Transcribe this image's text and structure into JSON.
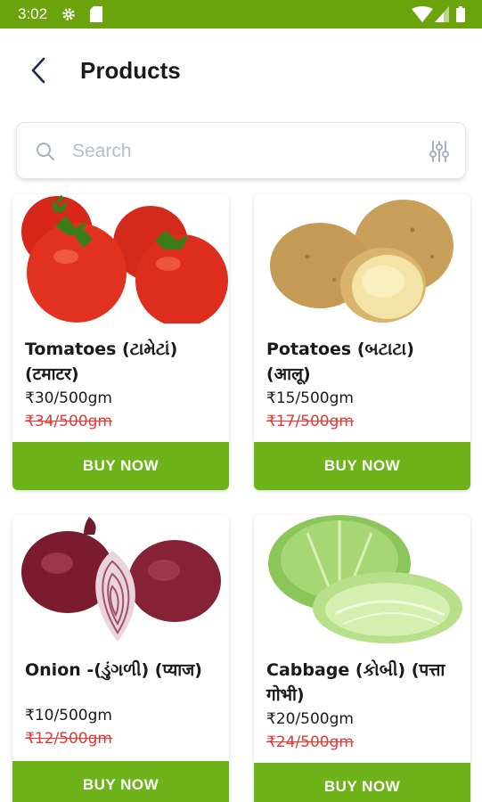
{
  "status_bar": {
    "time": "3:02",
    "icons": [
      "gear-icon",
      "sd-card-icon",
      "wifi-icon",
      "signal-icon",
      "battery-icon"
    ],
    "background_color": "#6aa30b"
  },
  "header": {
    "back_icon": "chevron-left-icon",
    "title": "Products"
  },
  "search": {
    "placeholder": "Search",
    "value": "",
    "icon": "search-icon",
    "filter_icon": "sliders-icon"
  },
  "products": [
    {
      "name": "Tomatoes (ટામેટાં) (टमाटर)",
      "price": "₹30/500gm",
      "mrp": "₹34/500gm",
      "button": "BUY NOW",
      "image": "tomatoes-image"
    },
    {
      "name": "Potatoes (બટાટા) (आलू)",
      "price": "₹15/500gm",
      "mrp": "₹17/500gm",
      "button": "BUY NOW",
      "image": "potatoes-image"
    },
    {
      "name": "Onion -(ડુંગળી) (प्याज)",
      "price": "₹10/500gm",
      "mrp": "₹12/500gm",
      "button": "BUY NOW",
      "image": "onion-image"
    },
    {
      "name": "Cabbage (કોબી) (पत्ता गोभी)",
      "price": "₹20/500gm",
      "mrp": "₹24/500gm",
      "button": "BUY NOW",
      "image": "cabbage-image"
    }
  ],
  "colors": {
    "accent_green": "#6fb31b",
    "mrp_red": "#e53935",
    "title_dark": "#1a1a1a"
  }
}
